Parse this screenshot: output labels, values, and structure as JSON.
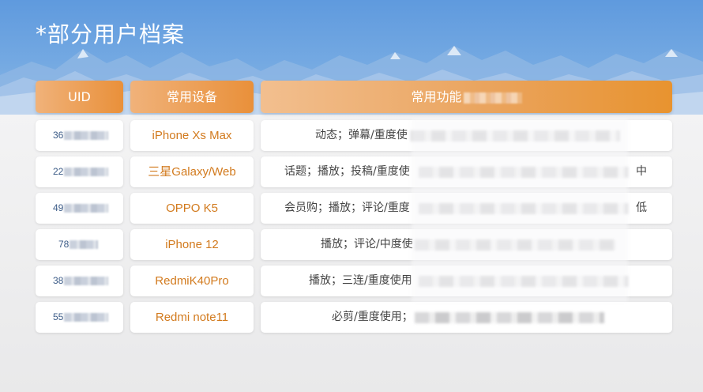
{
  "page": {
    "title": "*部分用户档案"
  },
  "colors": {
    "banner": "#6aa3e0",
    "header_orange": "#e9903a",
    "device_text": "#d27a1d",
    "uid_text": "#3a5a86"
  },
  "table": {
    "headers": {
      "uid": "UID",
      "device": "常用设备",
      "features": "常用功能"
    },
    "rows": [
      {
        "uid_prefix": "36",
        "device": "iPhone Xs Max",
        "features": "动态；弹幕/重度使",
        "tail": ""
      },
      {
        "uid_prefix": "22",
        "device": "三星Galaxy/Web",
        "features": "话题；播放；投稿/重度使",
        "tail": "中"
      },
      {
        "uid_prefix": "49",
        "device": "OPPO K5",
        "features": "会员购；播放；评论/重度",
        "tail": "低"
      },
      {
        "uid_prefix": "78",
        "device": "iPhone 12",
        "features": "播放；评论/中度使",
        "tail": ""
      },
      {
        "uid_prefix": "38",
        "device": "RedmiK40Pro",
        "features": "播放；三连/重度使用",
        "tail": ""
      },
      {
        "uid_prefix": "55",
        "device": "Redmi note11",
        "features": "必剪/重度使用；",
        "tail": ""
      }
    ]
  }
}
